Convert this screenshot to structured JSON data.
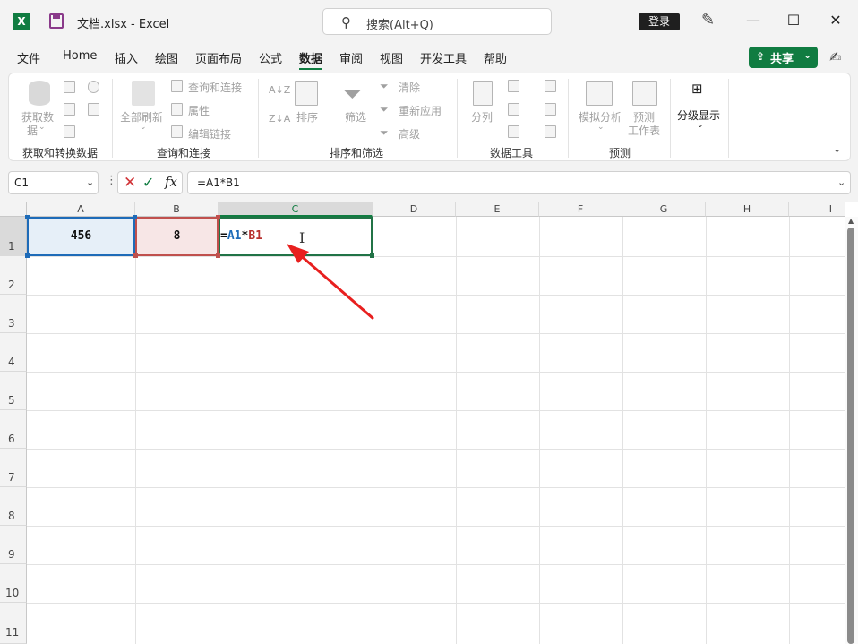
{
  "window": {
    "app_icon": "X",
    "doc_title": "文档.xlsx  -  Excel",
    "search_placeholder": "搜索(Alt+Q)",
    "login": "登录",
    "minimize": "—",
    "maximize": "☐",
    "close": "✕"
  },
  "menu": {
    "items": [
      "文件",
      "Home",
      "插入",
      "绘图",
      "页面布局",
      "公式",
      "数据",
      "审阅",
      "视图",
      "开发工具",
      "帮助"
    ],
    "active": "数据",
    "share": "共享"
  },
  "ribbon": {
    "groups": {
      "get_transform": {
        "label": "获取和转换数据",
        "get_data": "获取数",
        "get_data_2": "据"
      },
      "queries": {
        "label": "查询和连接",
        "refresh_all": "全部刷新",
        "queries_connections": "查询和连接",
        "properties": "属性",
        "edit_links": "编辑链接"
      },
      "sort_filter": {
        "label": "排序和筛选",
        "sort": "排序",
        "filter": "筛选",
        "clear": "清除",
        "reapply": "重新应用",
        "advanced": "高级"
      },
      "data_tools": {
        "label": "数据工具",
        "text_to_columns": "分列"
      },
      "forecast": {
        "label": "预测",
        "what_if": "模拟分析",
        "forecast_sheet": "预测",
        "forecast_sheet_2": "工作表"
      },
      "outline": {
        "group": "分级显示"
      }
    }
  },
  "formula_bar": {
    "name_box": "C1",
    "formula": "=A1*B1"
  },
  "grid": {
    "columns": [
      "A",
      "B",
      "C",
      "D",
      "E",
      "F",
      "G",
      "H",
      "I"
    ],
    "rows": [
      "1",
      "2",
      "3",
      "4",
      "5",
      "6",
      "7",
      "8",
      "9",
      "10",
      "11"
    ],
    "selected_column": "C",
    "cells": {
      "A1": "456",
      "B1": "8",
      "C1": {
        "eq": "=",
        "ref1": "A1",
        "op": "*",
        "ref2": "B1"
      }
    }
  },
  "colors": {
    "accent": "#107c41",
    "ref_blue": "#1e6bb8",
    "ref_red": "#c0504d",
    "annotation_arrow": "#e8201f"
  }
}
